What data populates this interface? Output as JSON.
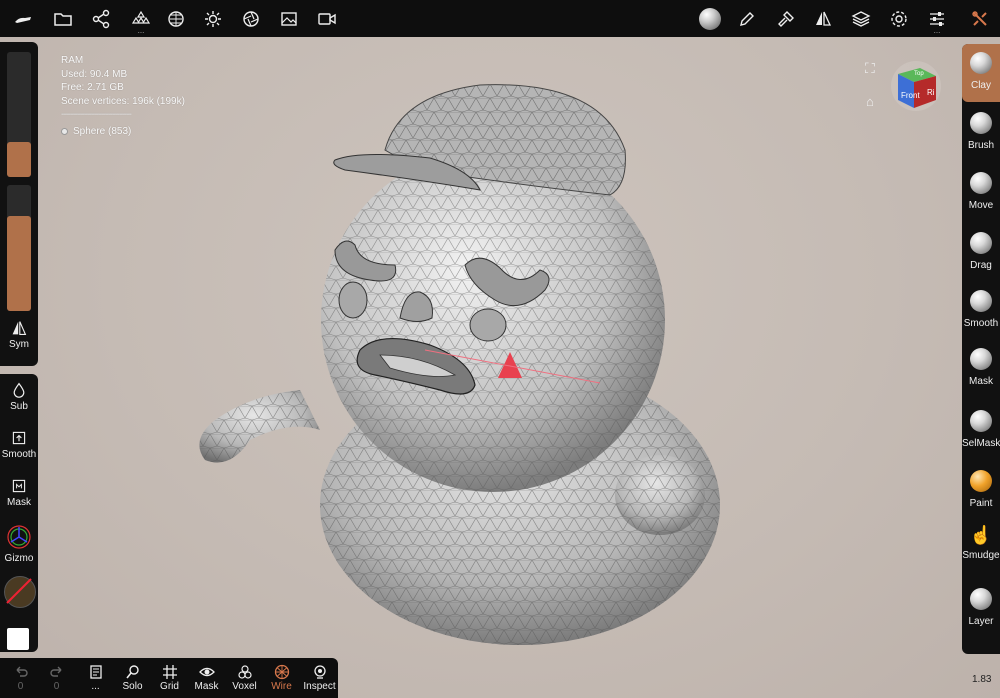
{
  "stats": {
    "ram_label": "RAM",
    "used": "Used: 90.4 MB",
    "free": "Free: 2.71 GB",
    "vertices": "Scene vertices: 196k (199k)",
    "separator": "------------------------------",
    "object": "Sphere (853)"
  },
  "left_tools": [
    {
      "id": "sym",
      "label": "Sym",
      "icon": "symmetry-icon"
    },
    {
      "id": "sub",
      "label": "Sub",
      "icon": "drop-icon"
    },
    {
      "id": "smooth",
      "label": "Smooth",
      "icon": "arrow-up-box-icon"
    },
    {
      "id": "mask",
      "label": "Mask",
      "icon": "mask-box-icon"
    },
    {
      "id": "gizmo",
      "label": "Gizmo",
      "icon": "gizmo-icon"
    }
  ],
  "sliders": {
    "radius_fraction": 0.28,
    "intensity_fraction": 0.75
  },
  "bottom_tools": [
    {
      "label": "",
      "icon": "undo-icon",
      "sub": "0"
    },
    {
      "label": "",
      "icon": "redo-icon",
      "sub": "0"
    },
    {
      "label": "...",
      "icon": "notes-icon"
    },
    {
      "label": "Solo",
      "icon": "search-icon"
    },
    {
      "label": "Grid",
      "icon": "grid-icon"
    },
    {
      "label": "Mask",
      "icon": "eye-icon"
    },
    {
      "label": "Voxel",
      "icon": "voxel-icon"
    },
    {
      "label": "Wire",
      "icon": "wire-icon"
    },
    {
      "label": "Inspect",
      "icon": "inspect-icon"
    }
  ],
  "right_tools": [
    {
      "label": "Clay",
      "active": true
    },
    {
      "label": "Brush"
    },
    {
      "label": "Move"
    },
    {
      "label": "Drag"
    },
    {
      "label": "Smooth"
    },
    {
      "label": "Mask"
    },
    {
      "label": "SelMask"
    },
    {
      "label": "Paint"
    },
    {
      "label": "Smudge"
    },
    {
      "label": "Layer"
    }
  ],
  "nav_cube": {
    "front": "Front",
    "right": "Ri",
    "top": "Top"
  },
  "version": "1.83",
  "colors": {
    "accent": "#b0714a",
    "background": "#c6bcb5",
    "panel": "#111111",
    "wire_active": "#d8784c"
  }
}
